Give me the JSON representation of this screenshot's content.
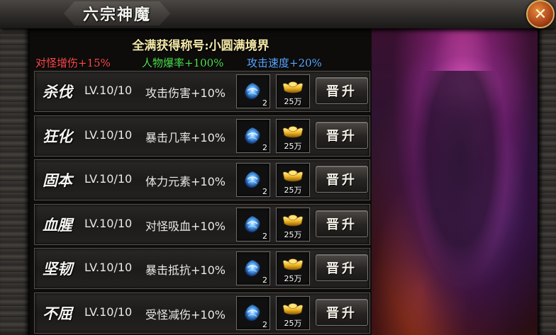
{
  "window": {
    "title": "六宗神魔",
    "close_label": "✕"
  },
  "header": {
    "title": "全满获得称号:小圆满境界",
    "bonuses": [
      "对怪增伤+15%",
      "人物爆率+100%",
      "攻击速度+20%"
    ]
  },
  "colors": {
    "bonus_1": "#ff4a4a",
    "bonus_2": "#4ee04e",
    "bonus_3": "#5aa8ff",
    "close_button": "#a8421a"
  },
  "rows": [
    {
      "name": "杀伐",
      "level": "LV.10/10",
      "effect": "攻击伤害+10%",
      "gem_icon": "blue-gem-icon",
      "gem_count": "2",
      "gold_icon": "gold-ingot-icon",
      "gold_count": "25万",
      "button": "晋升"
    },
    {
      "name": "狂化",
      "level": "LV.10/10",
      "effect": "暴击几率+10%",
      "gem_icon": "blue-gem-icon",
      "gem_count": "2",
      "gold_icon": "gold-ingot-icon",
      "gold_count": "25万",
      "button": "晋升"
    },
    {
      "name": "固本",
      "level": "LV.10/10",
      "effect": "体力元素+10%",
      "gem_icon": "blue-gem-icon",
      "gem_count": "2",
      "gold_icon": "gold-ingot-icon",
      "gold_count": "25万",
      "button": "晋升"
    },
    {
      "name": "血腥",
      "level": "LV.10/10",
      "effect": "对怪吸血+10%",
      "gem_icon": "blue-gem-icon",
      "gem_count": "2",
      "gold_icon": "gold-ingot-icon",
      "gold_count": "25万",
      "button": "晋升"
    },
    {
      "name": "坚韧",
      "level": "LV.10/10",
      "effect": "暴击抵抗+10%",
      "gem_icon": "blue-gem-icon",
      "gem_count": "2",
      "gold_icon": "gold-ingot-icon",
      "gold_count": "25万",
      "button": "晋升"
    },
    {
      "name": "不屈",
      "level": "LV.10/10",
      "effect": "受怪减伤+10%",
      "gem_icon": "blue-gem-icon",
      "gem_count": "2",
      "gold_icon": "gold-ingot-icon",
      "gold_count": "25万",
      "button": "晋升"
    }
  ]
}
